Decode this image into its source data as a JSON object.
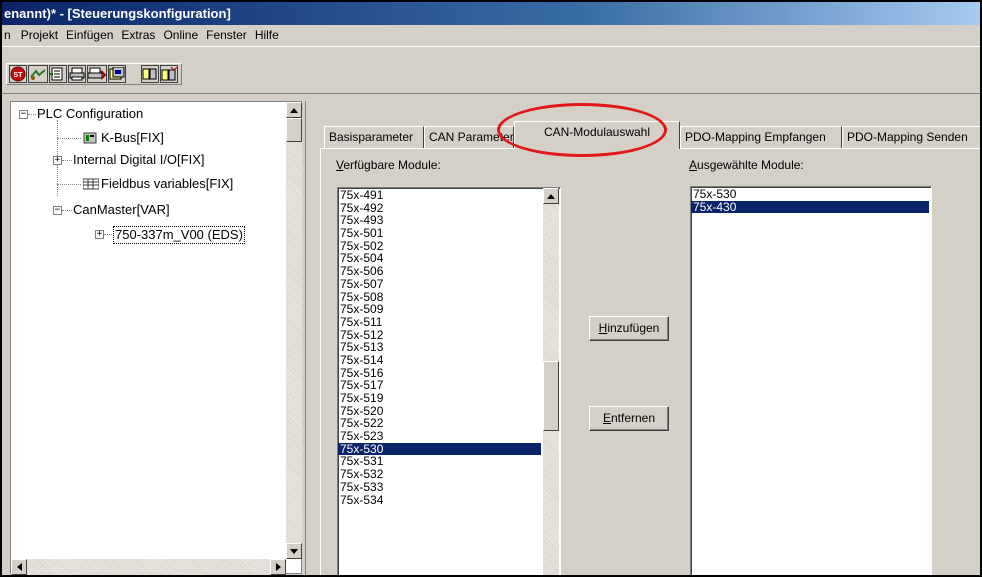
{
  "window": {
    "title": "enannt)* - [Steuerungskonfiguration]"
  },
  "menu": {
    "items": [
      "n",
      "Projekt",
      "Einfügen",
      "Extras",
      "Online",
      "Fenster",
      "Hilfe"
    ]
  },
  "toolbar": {
    "icons": [
      "stop-icon",
      "build-icon",
      "config-icon",
      "print-preview-icon",
      "print-icon",
      "download-icon",
      "split-icon",
      "merge-icon"
    ]
  },
  "tree": {
    "root": "PLC Configuration",
    "items": [
      {
        "label": "K-Bus[FIX]",
        "icon": "module-icon"
      },
      {
        "label": "Internal Digital I/O[FIX]",
        "icon": ""
      },
      {
        "label": "Fieldbus variables[FIX]",
        "icon": "fieldbus-icon"
      },
      {
        "label": "CanMaster[VAR]",
        "icon": ""
      },
      {
        "label": "750-337m_V00 (EDS)",
        "icon": ""
      }
    ]
  },
  "tabs": [
    "Basisparameter",
    "CAN Parameter",
    "CAN-Modulauswahl",
    "PDO-Mapping Empfangen",
    "PDO-Mapping Senden"
  ],
  "active_tab": "CAN-Modulauswahl",
  "available": {
    "label": "Verfügbare Module:",
    "items": [
      "75x-491",
      "75x-492",
      "75x-493",
      "75x-501",
      "75x-502",
      "75x-504",
      "75x-506",
      "75x-507",
      "75x-508",
      "75x-509",
      "75x-511",
      "75x-512",
      "75x-513",
      "75x-514",
      "75x-516",
      "75x-517",
      "75x-519",
      "75x-520",
      "75x-522",
      "75x-523",
      "75x-530",
      "75x-531",
      "75x-532",
      "75x-533",
      "75x-534"
    ],
    "selected": "75x-530"
  },
  "buttons": {
    "add": "Hinzufügen",
    "remove": "Entfernen"
  },
  "chosen": {
    "label": "Ausgewählte Module:",
    "items": [
      "75x-530",
      "75x-430"
    ],
    "selected": "75x-430"
  },
  "colors": {
    "selection": "#0a246a",
    "annotation": "#e01818"
  }
}
